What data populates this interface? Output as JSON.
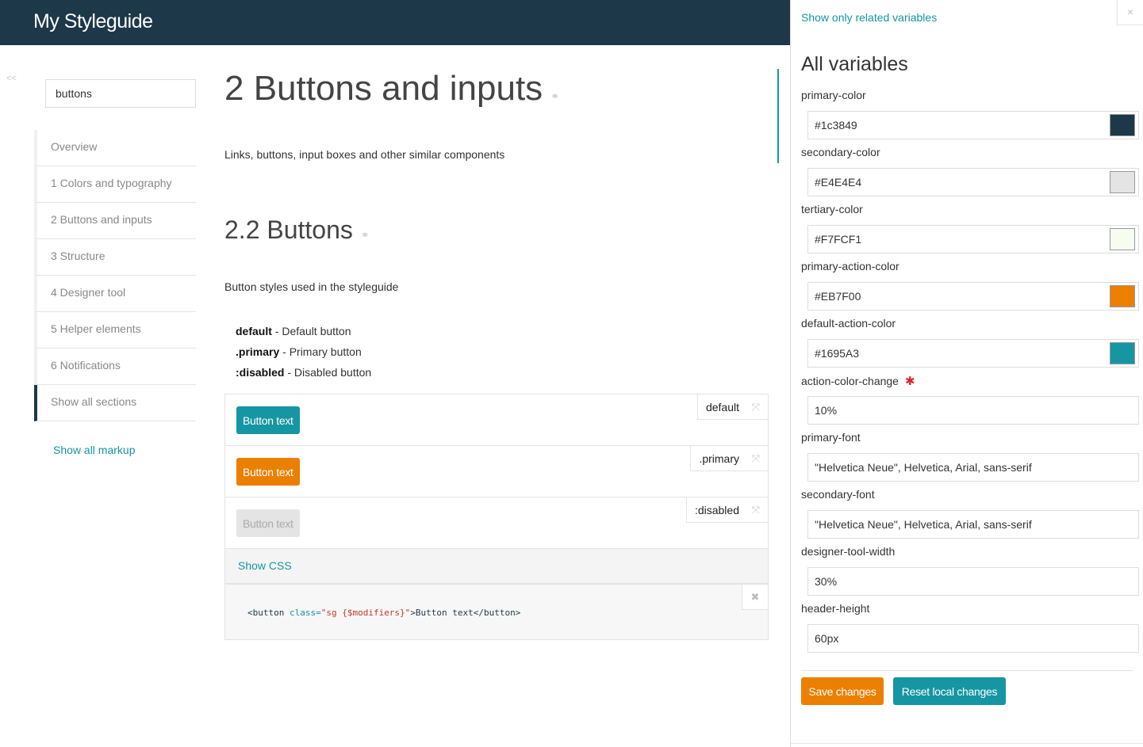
{
  "header": {
    "title": "My Styleguide"
  },
  "sidebar": {
    "collapse": "<<",
    "search_value": "buttons",
    "items": [
      {
        "label": "Overview",
        "active": false
      },
      {
        "label": "1 Colors and typography",
        "active": false
      },
      {
        "label": "2 Buttons and inputs",
        "active": false
      },
      {
        "label": "3 Structure",
        "active": false
      },
      {
        "label": "4 Designer tool",
        "active": false
      },
      {
        "label": "5 Helper elements",
        "active": false
      },
      {
        "label": "6 Notifications",
        "active": false
      },
      {
        "label": "Show all sections",
        "active": true
      }
    ],
    "show_markup": "Show all markup"
  },
  "main": {
    "title": "2 Buttons and inputs",
    "description": "Links, buttons, input boxes and other similar components",
    "subtitle": "2.2 Buttons",
    "sub_description": "Button styles used in the styleguide",
    "modifiers": [
      {
        "name": "default",
        "desc": " - Default button"
      },
      {
        "name": ".primary",
        "desc": " - Primary button"
      },
      {
        "name": ":disabled",
        "desc": " - Disabled button"
      }
    ],
    "examples": [
      {
        "button": "Button text",
        "tag": "default"
      },
      {
        "button": "Button text",
        "tag": ".primary"
      },
      {
        "button": "Button text",
        "tag": ":disabled"
      }
    ],
    "show_css": "Show CSS",
    "code": {
      "open": "<button",
      "attr": " class=",
      "value": "\"sg {$modifiers}\"",
      "rest": ">Button text</button>"
    }
  },
  "panel": {
    "related_link": "Show only related variables",
    "close": "×",
    "title": "All variables",
    "variables": [
      {
        "name": "primary-color",
        "value": "#1c3849",
        "swatch": "#1c3849"
      },
      {
        "name": "secondary-color",
        "value": "#E4E4E4",
        "swatch": "#E4E4E4"
      },
      {
        "name": "tertiary-color",
        "value": "#F7FCF1",
        "swatch": "#F7FCF1"
      },
      {
        "name": "primary-action-color",
        "value": "#EB7F00",
        "swatch": "#EB7F00"
      },
      {
        "name": "default-action-color",
        "value": "#1695A3",
        "swatch": "#1695A3"
      },
      {
        "name": "action-color-change",
        "value": "10%",
        "required": "✱"
      },
      {
        "name": "primary-font",
        "value": "\"Helvetica Neue\", Helvetica, Arial, sans-serif"
      },
      {
        "name": "secondary-font",
        "value": "\"Helvetica Neue\", Helvetica, Arial, sans-serif"
      },
      {
        "name": "designer-tool-width",
        "value": "30%"
      },
      {
        "name": "header-height",
        "value": "60px"
      }
    ],
    "save_label": "Save changes",
    "reset_label": "Reset local changes"
  },
  "icons": {
    "link": "link-icon",
    "close": "close-icon",
    "expand": "expand-icon"
  },
  "colors": {
    "header_bg": "#1c3849",
    "accent": "#1695a3",
    "primary_action": "#eb7f00"
  }
}
